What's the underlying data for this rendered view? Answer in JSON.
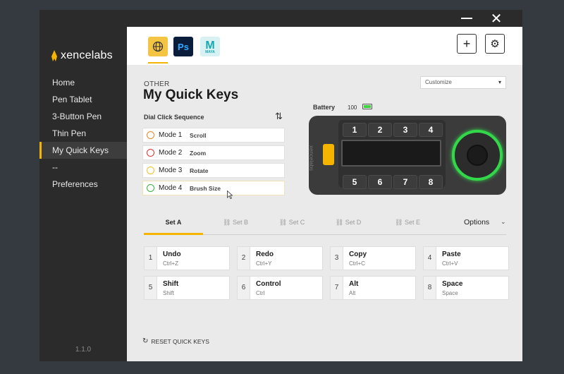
{
  "window": {
    "minimize_label": "",
    "close_label": "✕"
  },
  "brand": {
    "name": "xencelabs"
  },
  "nav": {
    "items": [
      {
        "label": "Home"
      },
      {
        "label": "Pen Tablet"
      },
      {
        "label": "3-Button Pen"
      },
      {
        "label": "Thin Pen"
      },
      {
        "label": "My Quick Keys",
        "active": true
      },
      {
        "label": "--"
      },
      {
        "label": "Preferences"
      }
    ]
  },
  "version": "1.1.0",
  "app_tabs": [
    {
      "name": "globe-icon",
      "label": ""
    },
    {
      "name": "photoshop",
      "label": "Ps"
    },
    {
      "name": "maya",
      "label": "M",
      "sublabel": "MAYA"
    }
  ],
  "header": {
    "add_icon": "+",
    "settings_icon": "⚙"
  },
  "page": {
    "category": "OTHER",
    "title": "My Quick Keys",
    "customize": "Customize"
  },
  "dial": {
    "label": "Dial Click Sequence",
    "modes": [
      {
        "name": "Mode 1",
        "action": "Scroll",
        "color": "#e8892b"
      },
      {
        "name": "Mode 2",
        "action": "Zoom",
        "color": "#d93636"
      },
      {
        "name": "Mode 3",
        "action": "Rotate",
        "color": "#f0c030"
      },
      {
        "name": "Mode 4",
        "action": "Brush Size",
        "color": "#3cb043"
      }
    ]
  },
  "battery": {
    "label": "Battery",
    "value": "100"
  },
  "device": {
    "logo": "xencelabs",
    "keys_top": [
      "1",
      "2",
      "3",
      "4"
    ],
    "keys_bottom": [
      "5",
      "6",
      "7",
      "8"
    ]
  },
  "sets": {
    "tabs": [
      "Set A",
      "Set B",
      "Set C",
      "Set D",
      "Set E"
    ],
    "options": "Options"
  },
  "quick_keys": [
    {
      "num": "1",
      "name": "Undo",
      "shortcut": "Ctrl+Z"
    },
    {
      "num": "2",
      "name": "Redo",
      "shortcut": "Ctrl+Y"
    },
    {
      "num": "3",
      "name": "Copy",
      "shortcut": "Ctrl+C"
    },
    {
      "num": "4",
      "name": "Paste",
      "shortcut": "Ctrl+V"
    },
    {
      "num": "5",
      "name": "Shift",
      "shortcut": "Shift"
    },
    {
      "num": "6",
      "name": "Control",
      "shortcut": "Ctrl"
    },
    {
      "num": "7",
      "name": "Alt",
      "shortcut": "Alt"
    },
    {
      "num": "8",
      "name": "Space",
      "shortcut": "Space"
    }
  ],
  "reset": {
    "label": "RESET QUICK KEYS"
  }
}
